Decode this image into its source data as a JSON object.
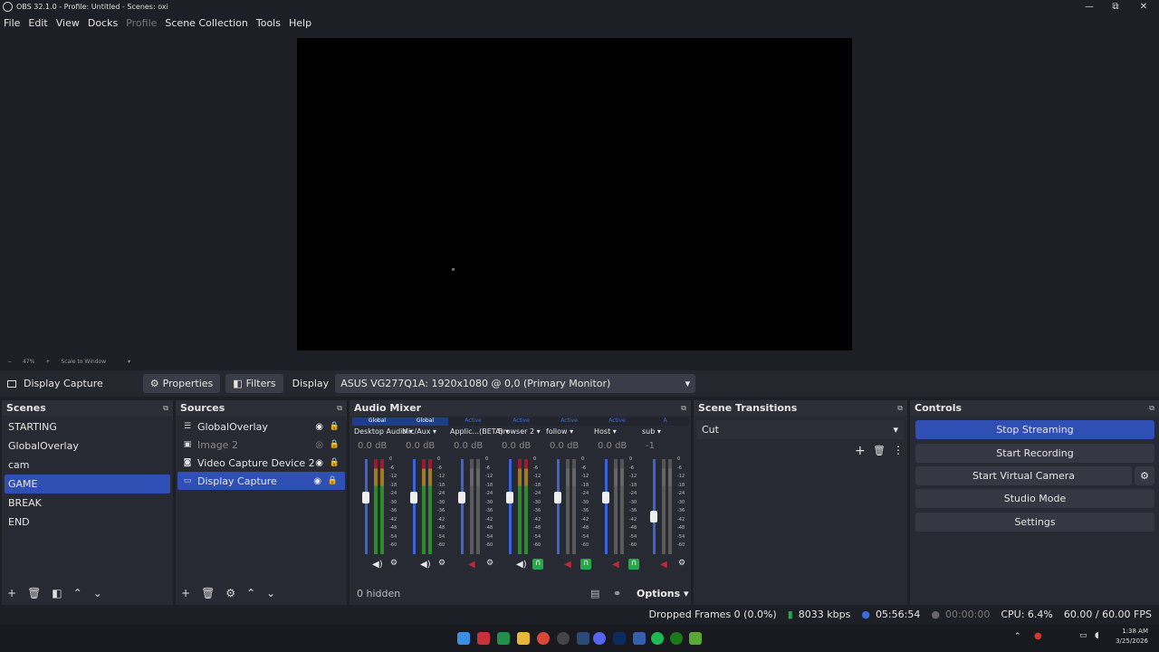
{
  "window": {
    "title": "OBS 32.1.0 - Profile: Untitled - Scenes: oxi",
    "min": "—",
    "max": "⧉",
    "close": "✕"
  },
  "menu": [
    "File",
    "Edit",
    "View",
    "Docks",
    "Profile",
    "Scene Collection",
    "Tools",
    "Help"
  ],
  "zoom": {
    "minus": "−",
    "level": "47%",
    "plus": "+",
    "mode": "Scale to Window",
    "chevron": "▾"
  },
  "source_bar": {
    "source_name": "Display Capture",
    "properties_label": "Properties",
    "filters_label": "Filters",
    "display_label": "Display",
    "display_value": "ASUS VG277Q1A: 1920x1080 @ 0,0 (Primary Monitor)"
  },
  "scenes": {
    "title": "Scenes",
    "items": [
      "STARTING",
      "GlobalOverlay",
      "cam",
      "GAME",
      "BREAK",
      "END"
    ],
    "selected": "GAME"
  },
  "sources": {
    "title": "Sources",
    "items": [
      {
        "name": "GlobalOverlay",
        "icon": "list-icon"
      },
      {
        "name": "Image 2",
        "icon": "image-icon"
      },
      {
        "name": "Video Capture Device 2",
        "icon": "camera-icon"
      },
      {
        "name": "Display Capture",
        "icon": "monitor-icon"
      }
    ]
  },
  "mixer": {
    "title": "Audio Mixer",
    "hidden_label": "0 hidden",
    "options_label": "Options",
    "channels": [
      {
        "tag": "Global",
        "name": "Desktop Audio",
        "db": "0.0 dB",
        "level": 0.6,
        "muted": false,
        "monitor": false,
        "meter": "color"
      },
      {
        "tag": "Global",
        "name": "Mic/Aux",
        "db": "0.0 dB",
        "level": 0.6,
        "muted": false,
        "monitor": false,
        "meter": "color"
      },
      {
        "tag": "Active",
        "name": "Applic...(BETA)",
        "db": "0.0 dB",
        "level": 0.6,
        "muted": true,
        "monitor": false,
        "meter": "grey"
      },
      {
        "tag": "Active",
        "name": "Browser 2",
        "db": "0.0 dB",
        "level": 0.6,
        "muted": false,
        "monitor": true,
        "meter": "color"
      },
      {
        "tag": "Active",
        "name": "follow",
        "db": "0.0 dB",
        "level": 0.6,
        "muted": true,
        "monitor": true,
        "meter": "grey"
      },
      {
        "tag": "Active",
        "name": "Host",
        "db": "0.0 dB",
        "level": 0.6,
        "muted": true,
        "monitor": true,
        "meter": "grey"
      },
      {
        "tag": "A",
        "name": "sub",
        "db": "-1",
        "level": 0.4,
        "muted": true,
        "monitor": false,
        "meter": "grey"
      }
    ],
    "scale": [
      "0",
      "-6",
      "-12",
      "-18",
      "-24",
      "-30",
      "-36",
      "-42",
      "-48",
      "-54",
      "-60"
    ]
  },
  "transitions": {
    "title": "Scene Transitions",
    "value": "Cut"
  },
  "controls": {
    "title": "Controls",
    "stop_streaming": "Stop Streaming",
    "start_recording": "Start Recording",
    "start_virtual_camera": "Start Virtual Camera",
    "studio_mode": "Studio Mode",
    "settings": "Settings"
  },
  "status": {
    "dropped": "Dropped Frames 0 (0.0%)",
    "kbps": "8033 kbps",
    "stream_time": "05:56:54",
    "rec_time": "00:00:00",
    "cpu": "CPU: 6.4%",
    "fps": "60.00 / 60.00 FPS"
  },
  "taskbar": {
    "time": "1:38 AM",
    "date": "3/25/2026"
  },
  "colors": {
    "accent": "#2f4fb5",
    "green": "#2aa54b",
    "red": "#c0283a"
  }
}
